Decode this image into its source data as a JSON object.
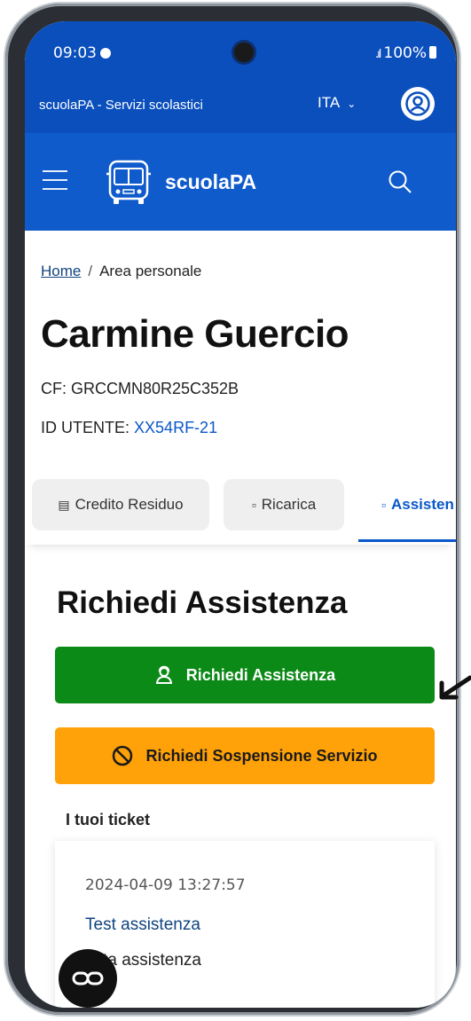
{
  "status_bar": {
    "time": "09:03",
    "battery": "100%",
    "signal": "signal-icon"
  },
  "top_bar": {
    "site_name": "scuolaPA - Servizi scolastici",
    "language": "ITA"
  },
  "header": {
    "brand": "scuolaPA"
  },
  "breadcrumb": {
    "home": "Home",
    "separator": "/",
    "current": "Area personale"
  },
  "profile": {
    "name": "Carmine Guercio",
    "cf": "CF: GRCCMN80R25C352B",
    "id_label": "ID UTENTE:",
    "id_value": "XX54RF-21"
  },
  "tabs": [
    {
      "label": "Credito Residuo",
      "icon": "wallet-icon"
    },
    {
      "label": "Ricarica",
      "icon": "document-icon"
    },
    {
      "label": "Assisten",
      "icon": "document-icon",
      "active": true
    }
  ],
  "assistance": {
    "title": "Richiedi Assistenza",
    "request_button": "Richiedi Assistenza",
    "suspend_button": "Richiedi Sospensione Servizio"
  },
  "tickets": {
    "title": "I tuoi ticket",
    "items": [
      {
        "date": "2024-04-09 13:27:57",
        "title": "Test assistenza",
        "description": "esta assistenza"
      }
    ]
  },
  "colors": {
    "primary": "#0b4fbd",
    "green": "#0c8a17",
    "orange": "#ffa109",
    "link": "#0a58ca"
  }
}
